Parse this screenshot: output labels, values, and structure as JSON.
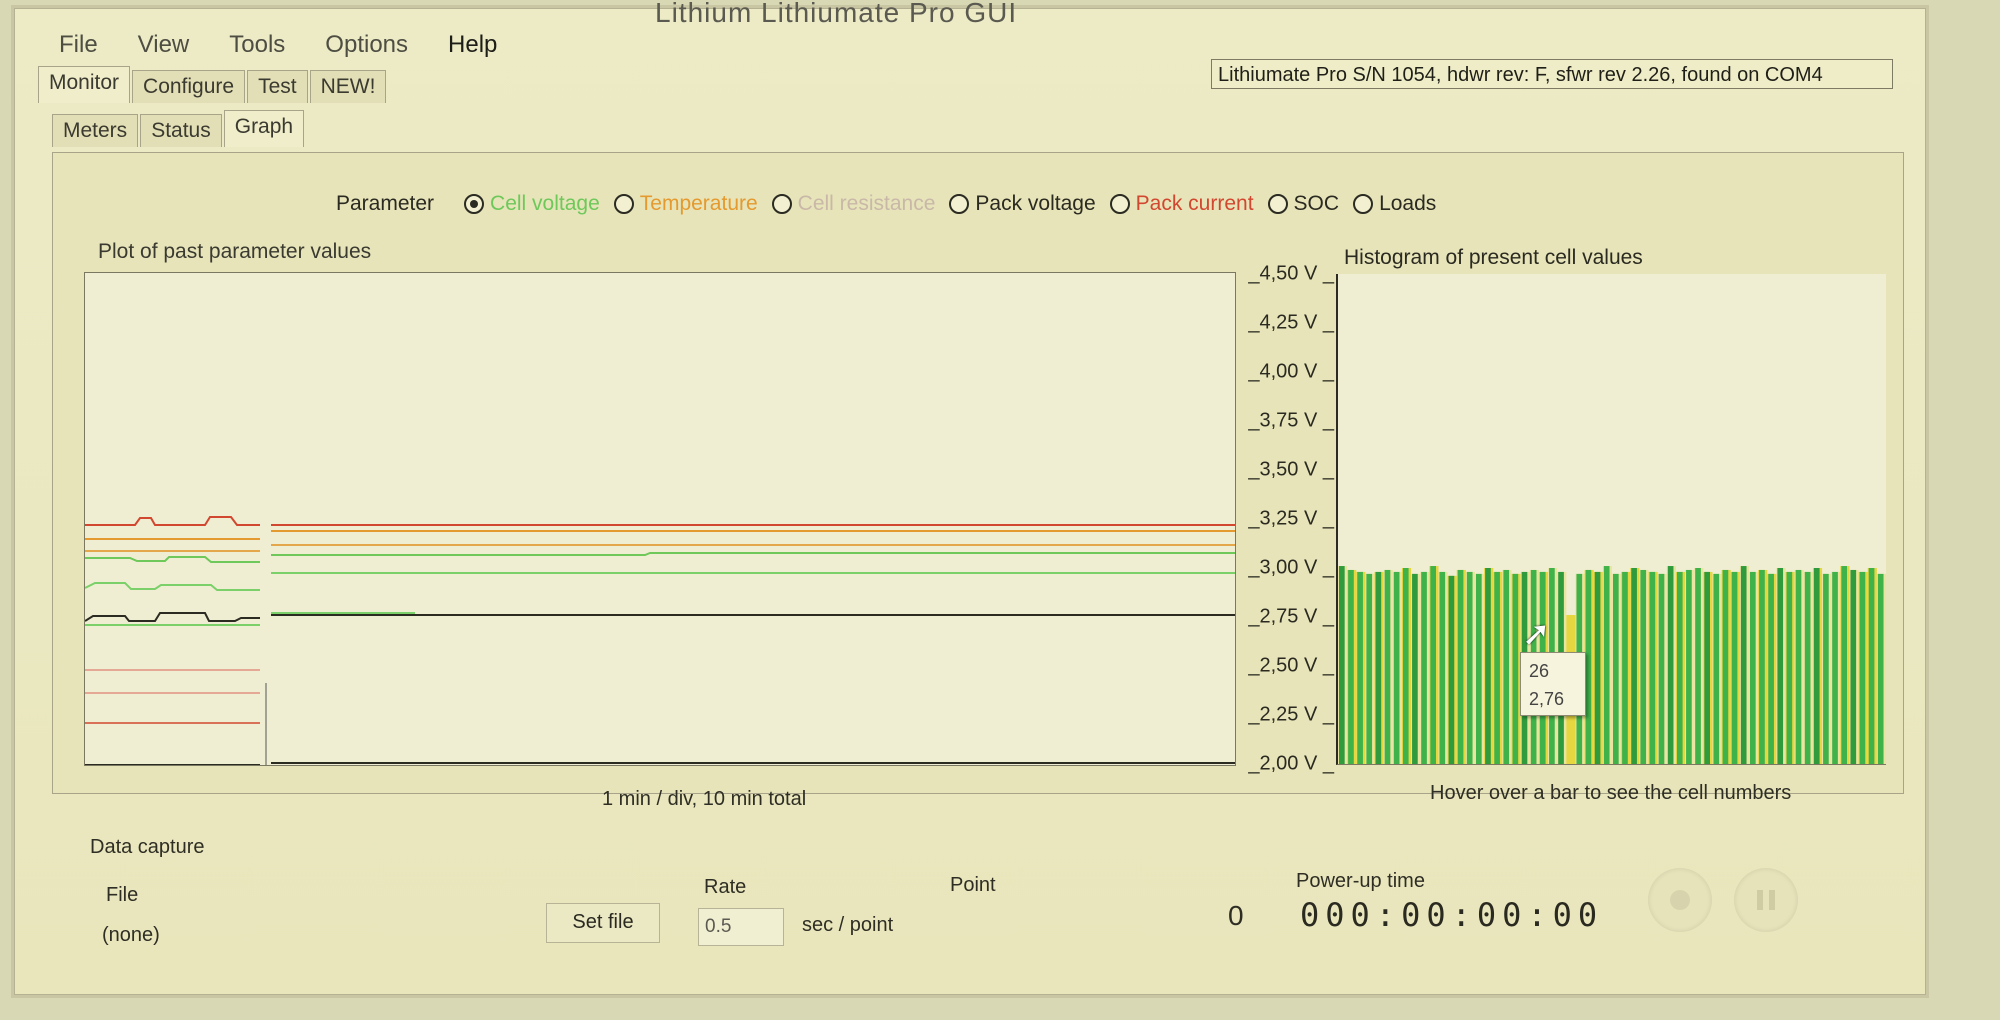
{
  "window": {
    "title": "Lithium Lithiumate Pro GUI"
  },
  "menu": [
    "File",
    "View",
    "Tools",
    "Options",
    "Help"
  ],
  "device_info": "Lithiumate Pro S/N 1054, hdwr rev: F, sfwr rev 2.26, found on COM4",
  "tabs_main": [
    "Monitor",
    "Configure",
    "Test",
    "NEW!"
  ],
  "tabs_sub": [
    "Meters",
    "Status",
    "Graph"
  ],
  "parameter": {
    "label": "Parameter",
    "options": [
      {
        "label": "Cell voltage",
        "color": "#6ec85a",
        "selected": true
      },
      {
        "label": "Temperature",
        "color": "#e49a2e",
        "selected": false
      },
      {
        "label": "Cell resistance",
        "color": "#c9b8a8",
        "selected": false
      },
      {
        "label": "Pack voltage",
        "color": "#2b2b22",
        "selected": false
      },
      {
        "label": "Pack current",
        "color": "#d2472f",
        "selected": false
      },
      {
        "label": "SOC",
        "color": "#2b2b22",
        "selected": false
      },
      {
        "label": "Loads",
        "color": "#2b2b22",
        "selected": false
      }
    ]
  },
  "plot": {
    "title": "Plot of past parameter values",
    "caption": "1 min / div, 10 min total"
  },
  "histogram": {
    "title": "Histogram of present cell values",
    "caption": "Hover over a bar to see the cell numbers"
  },
  "chart_data": {
    "type": "bar",
    "title": "Histogram of present cell values",
    "ylabel": "",
    "ylim": [
      2.0,
      4.5
    ],
    "yticks": [
      "2,00 V",
      "2,25 V",
      "2,50 V",
      "2,75 V",
      "3,00 V",
      "3,25 V",
      "3,50 V",
      "3,75 V",
      "4,00 V",
      "4,25 V",
      "4,50 V"
    ],
    "colors": {
      "normal": "#3fb24a",
      "alt": "#e6d640",
      "dark": "#2f9b3c"
    },
    "values": [
      3.01,
      2.99,
      2.98,
      2.97,
      2.98,
      2.99,
      2.98,
      3.0,
      2.97,
      2.98,
      3.01,
      2.98,
      2.96,
      2.99,
      2.98,
      2.97,
      3.0,
      2.98,
      2.99,
      2.97,
      2.98,
      2.99,
      2.98,
      3.0,
      2.98,
      2.76,
      2.97,
      2.99,
      2.98,
      3.01,
      2.97,
      2.98,
      3.0,
      2.99,
      2.98,
      2.97,
      3.01,
      2.98,
      2.99,
      3.0,
      2.98,
      2.97,
      2.99,
      2.98,
      3.01,
      2.98,
      2.99,
      2.97,
      3.0,
      2.98,
      2.99,
      2.98,
      3.0,
      2.97,
      2.98,
      3.01,
      2.99,
      2.98,
      3.0,
      2.97
    ],
    "tooltip": {
      "cell": "26",
      "value": "2,76"
    }
  },
  "data_capture": {
    "title": "Data capture",
    "file_label": "File",
    "file_value": "(none)",
    "set_file_label": "Set file",
    "rate_label": "Rate",
    "rate_value": "0.5",
    "rate_unit": "sec / point",
    "point_label": "Point",
    "point_value": "0",
    "powerup_label": "Power-up time",
    "powerup_value": "000:00:00:00"
  }
}
